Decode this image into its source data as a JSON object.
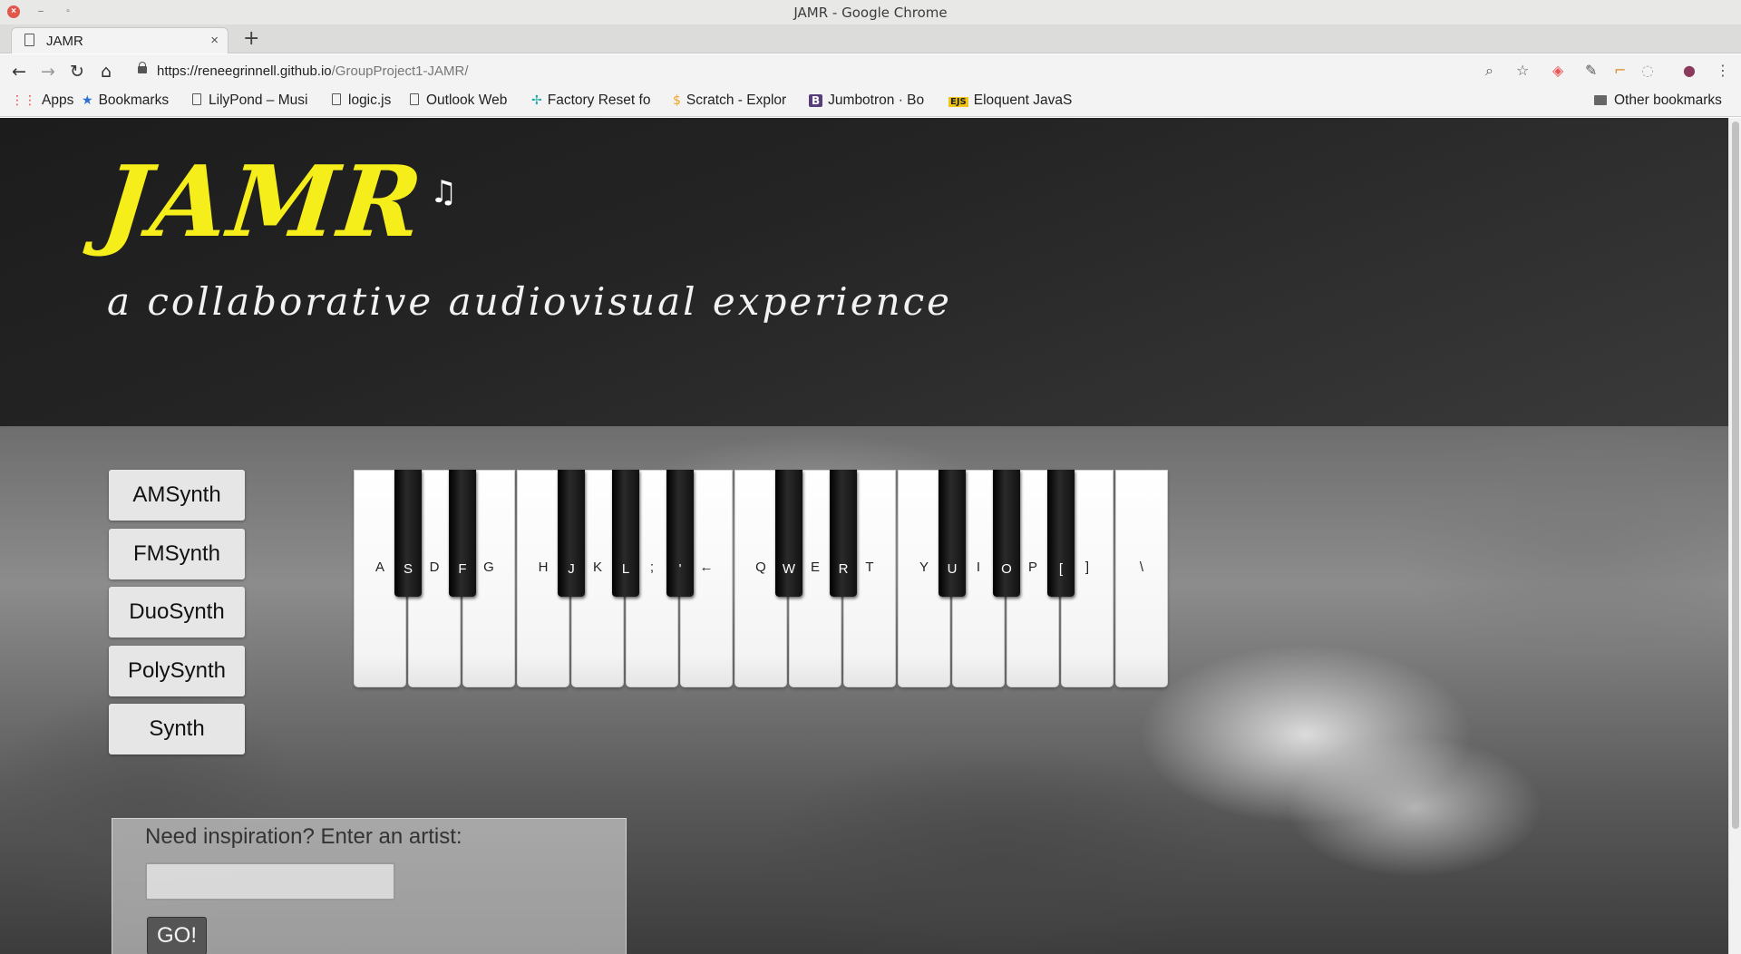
{
  "window": {
    "title": "JAMR - Google Chrome"
  },
  "tab": {
    "label": "JAMR",
    "close": "×",
    "new": "+"
  },
  "toolbar": {
    "url_host": "https://reneegrinnell.github.io",
    "url_path": "/GroupProject1-JAMR/",
    "back": "←",
    "forward": "→",
    "reload": "↻",
    "home": "⌂"
  },
  "bookmarks": [
    {
      "label": "Apps",
      "icon": "apps-grid-icon",
      "glyph": "⋮⋮"
    },
    {
      "label": "Bookmarks",
      "icon": "star-icon",
      "glyph": "★"
    },
    {
      "label": "LilyPond – Musi",
      "icon": "page-icon"
    },
    {
      "label": "logic.js",
      "icon": "page-icon"
    },
    {
      "label": "Outlook Web",
      "icon": "page-icon"
    },
    {
      "label": "Factory Reset fo",
      "icon": "sparkle-icon",
      "glyph": "✢"
    },
    {
      "label": "Scratch - Explor",
      "icon": "scratch-icon",
      "glyph": "$"
    },
    {
      "label": "Jumbotron · Bo",
      "icon": "bootstrap-icon",
      "glyph": "B"
    },
    {
      "label": "Eloquent JavaS",
      "icon": "ejs-icon",
      "glyph": "EJS"
    }
  ],
  "other_bookmarks": "Other bookmarks",
  "page": {
    "logo": "JAMR",
    "logo_note": "♫",
    "tagline": "a collaborative audiovisual experience",
    "synths": [
      "AMSynth",
      "FMSynth",
      "DuoSynth",
      "PolySynth",
      "Synth"
    ],
    "white_keys": [
      "A",
      "D",
      "G",
      "H",
      "K",
      ";",
      "←",
      "Q",
      "E",
      "T",
      "Y",
      "I",
      "P",
      "]",
      "\\"
    ],
    "black_keys": [
      "S",
      "F",
      "J",
      "L",
      "'",
      "W",
      "R",
      "U",
      "O",
      "["
    ],
    "inspire_label": "Need inspiration? Enter an artist:",
    "artist_value": "",
    "go_label": "GO!"
  },
  "colors": {
    "logo": "#f6ee1a",
    "hero_bg": "#242424"
  }
}
